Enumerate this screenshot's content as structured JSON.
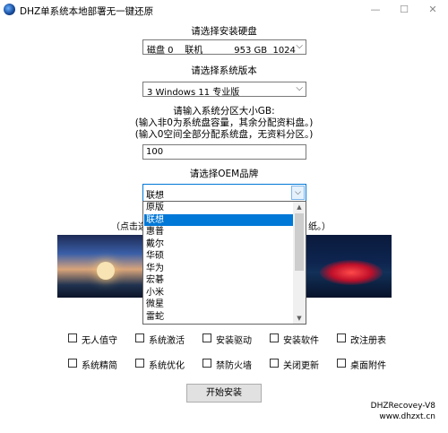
{
  "window": {
    "title": "DHZ单系统本地部署无一键还原",
    "controls": {
      "minimize": "—",
      "maximize": "☐",
      "close": "✕"
    }
  },
  "disk": {
    "label": "请选择安装硬盘",
    "selected": "磁盘 0    联机           953 GB  1024"
  },
  "version": {
    "label": "请选择系统版本",
    "selected": "3 Windows 11 专业版"
  },
  "partition": {
    "label": "请输入系统分区大小GB:",
    "hint1": "(输入非0为系统盘容量，其余分配资料盘。)",
    "hint2": "(输入0空间全部分配系统盘，无资料分区。)",
    "value": "100"
  },
  "oem": {
    "label": "请选择OEM品牌",
    "selected": "联想",
    "options": [
      "原版",
      "联想",
      "惠普",
      "戴尔",
      "华硕",
      "华为",
      "宏碁",
      "小米",
      "微星",
      "雷蛇"
    ],
    "highlighted_index": 1
  },
  "wallpaper_hint": {
    "left": "（点击选",
    "right": "纸。）"
  },
  "options_row1": [
    "无人值守",
    "系统激活",
    "安装驱动",
    "安装软件",
    "改注册表"
  ],
  "options_row2": [
    "系统精简",
    "系统优化",
    "禁防火墙",
    "关闭更新",
    "桌面附件"
  ],
  "actions": {
    "install": "开始安装"
  },
  "footer": {
    "version": "DHZRecovey-V8",
    "site": "www.dhzxt.cn"
  },
  "icons": {
    "dropdown": "chevron-down-icon",
    "app": "app-icon"
  }
}
